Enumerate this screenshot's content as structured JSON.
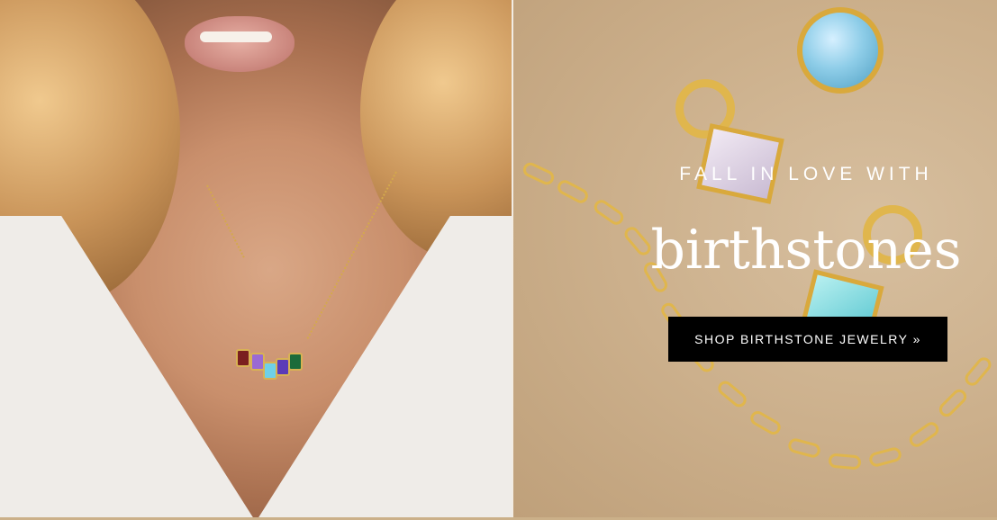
{
  "hero": {
    "headline": "FALL IN LOVE WITH",
    "title": "birthstones",
    "cta_label": "SHOP BIRTHSTONE JEWELRY »"
  },
  "images": {
    "left": "woman-wearing-birthstone-charm-necklace",
    "right": "gold-chain-and-birthstone-charms-flatlay"
  },
  "colors": {
    "cta_bg": "#000000",
    "text": "#ffffff",
    "backdrop": "#d8c3a5"
  }
}
